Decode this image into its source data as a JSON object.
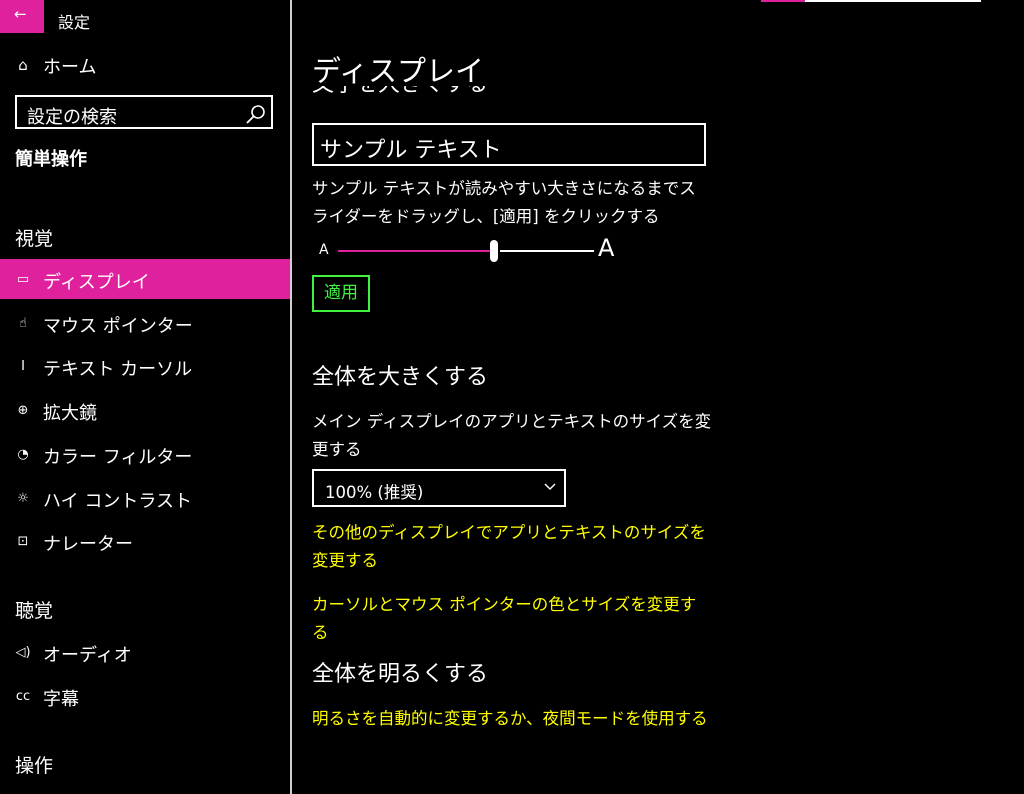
{
  "app": {
    "title": "設定",
    "back_icon": "←"
  },
  "nav": {
    "home_icon": "⌂",
    "home_label": "ホーム",
    "search_placeholder": "設定の検索",
    "category": "簡単操作",
    "section_vision": "視覚",
    "section_hearing": "聴覚",
    "section_interaction": "操作",
    "vision_items": [
      {
        "label": "ディスプレイ",
        "icon": "display-icon",
        "glyph": "▭",
        "active": true
      },
      {
        "label": "マウス ポインター",
        "icon": "mouse-pointer-icon",
        "glyph": "☝",
        "active": false
      },
      {
        "label": "テキスト カーソル",
        "icon": "text-cursor-icon",
        "glyph": "I",
        "active": false
      },
      {
        "label": "拡大鏡",
        "icon": "magnifier-icon",
        "glyph": "⊕",
        "active": false
      },
      {
        "label": "カラー フィルター",
        "icon": "color-filter-icon",
        "glyph": "◔",
        "active": false
      },
      {
        "label": "ハイ コントラスト",
        "icon": "high-contrast-icon",
        "glyph": "☼",
        "active": false
      },
      {
        "label": "ナレーター",
        "icon": "narrator-icon",
        "glyph": "⊡",
        "active": false
      }
    ],
    "hearing_items": [
      {
        "label": "オーディオ",
        "icon": "audio-icon",
        "glyph": "◁)",
        "active": false
      },
      {
        "label": "字幕",
        "icon": "captions-icon",
        "glyph": "cc",
        "active": false
      }
    ]
  },
  "content": {
    "page_title": "ディスプレイ",
    "clipped_heading": "文字を大きくする",
    "sample_text": "サンプル テキスト",
    "slider_description": "サンプル テキストが読みやすい大きさになるまでスライダーをドラッグし、[適用] をクリックする",
    "slider_small_label": "A",
    "slider_large_label": "A",
    "slider_value": 0.61,
    "apply_label": "適用",
    "make_everything_bigger": "全体を大きくする",
    "scale_description": "メイン ディスプレイのアプリとテキストのサイズを変更する",
    "scale_value": "100% (推奨)",
    "link_other_displays": "その他のディスプレイでアプリとテキストのサイズを変更する",
    "link_cursor": "カーソルとマウス ポインターの色とサイズを変更する",
    "make_everything_brighter": "全体を明るくする",
    "link_brightness": "明るさを自動的に変更するか、夜間モードを使用する"
  },
  "colors": {
    "accent": "#e0219e",
    "link": "#ffff00",
    "button": "#3ff23f",
    "background": "#000000",
    "text": "#ffffff"
  }
}
